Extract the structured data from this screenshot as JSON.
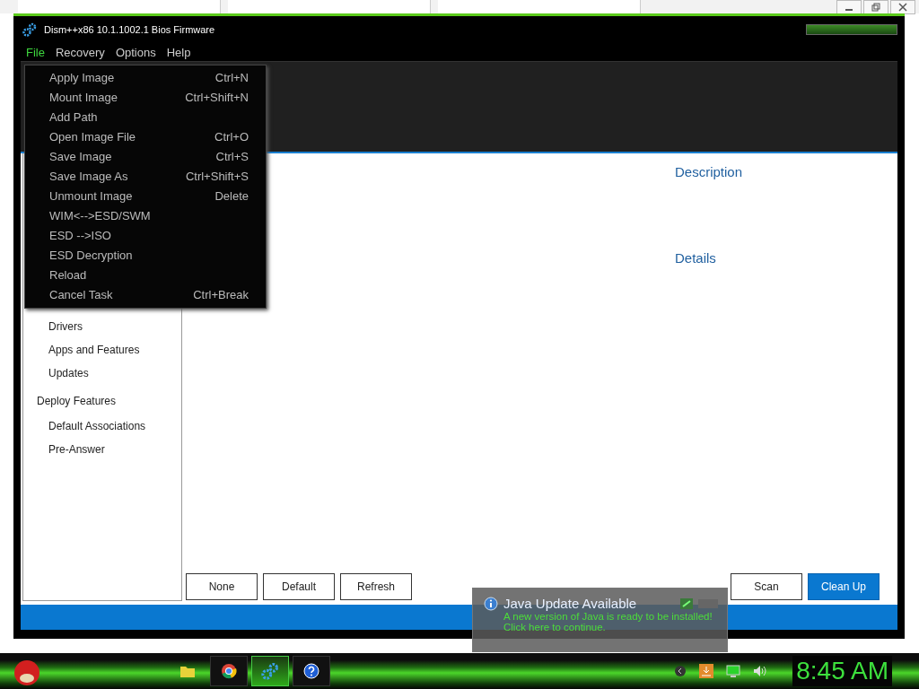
{
  "window": {
    "title": "Dism++x86 10.1.1002.1 Bios Firmware"
  },
  "menu_bar": [
    {
      "label": "File",
      "selected": true
    },
    {
      "label": "Recovery",
      "selected": false
    },
    {
      "label": "Options",
      "selected": false
    },
    {
      "label": "Help",
      "selected": false
    }
  ],
  "file_menu": [
    {
      "label": "Apply Image",
      "shortcut": "Ctrl+N"
    },
    {
      "label": "Mount Image",
      "shortcut": "Ctrl+Shift+N"
    },
    {
      "label": "Add Path"
    },
    {
      "label": "Open Image File",
      "shortcut": "Ctrl+O"
    },
    {
      "label": "Save Image",
      "shortcut": "Ctrl+S"
    },
    {
      "label": "Save Image As",
      "shortcut": "Ctrl+Shift+S"
    },
    {
      "label": "Unmount Image",
      "shortcut": "Delete"
    },
    {
      "label": "WIM<-->ESD/SWM"
    },
    {
      "label": "ESD -->ISO"
    },
    {
      "label": "ESD Decryption"
    },
    {
      "label": "Reload"
    },
    {
      "label": "Cancel Task",
      "shortcut": "Ctrl+Break"
    }
  ],
  "sidebar": {
    "items": [
      {
        "label": "Drivers",
        "kind": "item"
      },
      {
        "label": "Apps and Features",
        "kind": "item"
      },
      {
        "label": "Updates",
        "kind": "item"
      },
      {
        "label": "Deploy Features",
        "kind": "group"
      },
      {
        "label": "Default Associations",
        "kind": "item"
      },
      {
        "label": "Pre-Answer",
        "kind": "item"
      }
    ]
  },
  "panel": {
    "description_heading": "Description",
    "details_heading": "Details"
  },
  "buttons_left": [
    {
      "label": "None",
      "primary": false
    },
    {
      "label": "Default",
      "primary": false
    },
    {
      "label": "Refresh",
      "primary": false
    }
  ],
  "buttons_right": [
    {
      "label": "Scan",
      "primary": false
    },
    {
      "label": "Clean Up",
      "primary": true
    }
  ],
  "notification": {
    "title": "Java Update Available",
    "message": "A new version of Java is ready to be installed!",
    "link": "Click here to continue."
  },
  "taskbar": {
    "apps": [
      {
        "kind": "folder",
        "active": false
      },
      {
        "kind": "browser",
        "active": false
      },
      {
        "kind": "gears",
        "active": true
      },
      {
        "kind": "help",
        "active": false
      }
    ],
    "clock": "8:45 AM"
  }
}
